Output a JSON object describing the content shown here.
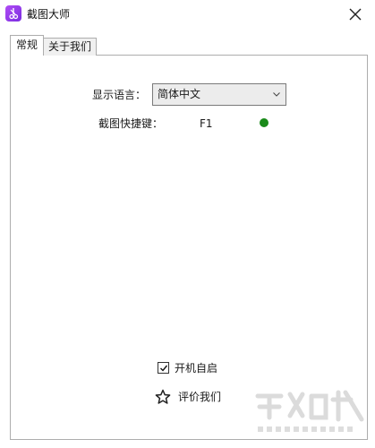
{
  "window": {
    "title": "截图大师"
  },
  "tabs": [
    {
      "label": "常规",
      "active": true
    },
    {
      "label": "关于我们",
      "active": false
    }
  ],
  "settings": {
    "language_label": "显示语言：",
    "language_value": "简体中文",
    "hotkey_label": "截图快捷键：",
    "hotkey_value": "F1",
    "hotkey_status_color": "#1a8a1a",
    "autostart_label": "开机自启",
    "autostart_checked": true,
    "rate_label": "评价我们"
  },
  "icons": {
    "app": "scissors-icon",
    "close": "close-icon",
    "dropdown": "chevron-down-icon",
    "checkbox": "checkmark-icon",
    "rate": "star-icon"
  },
  "colors": {
    "app_icon": "#9b3cf0",
    "status_ok": "#1a8a1a",
    "border": "#adadad"
  }
}
